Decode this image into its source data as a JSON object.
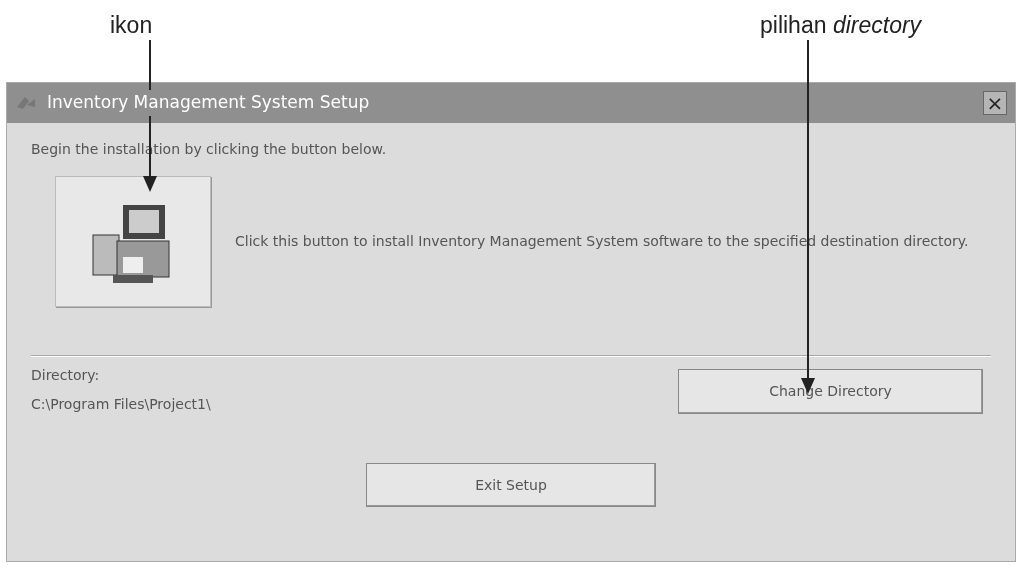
{
  "annotations": [
    {
      "text": "ikon"
    },
    {
      "text": "pilihan *directory*"
    }
  ],
  "window": {
    "title": "Inventory Management System Setup",
    "close": "×"
  },
  "intro": "Begin the installation by clicking the button below.",
  "install": {
    "description": "Click this button to install Inventory Management System software to the specified destination directory."
  },
  "directory": {
    "label": "Directory:",
    "path": "C:\\Program Files\\Project1\\",
    "button": "Change Directory"
  },
  "exit_button": "Exit Setup"
}
